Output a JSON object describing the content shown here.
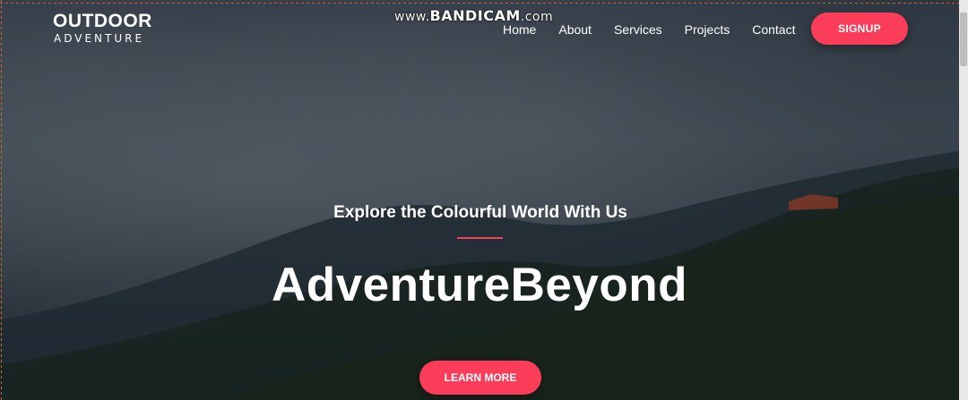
{
  "header": {
    "logo_main": "OUTDOOR",
    "logo_sub": "ADVENTURE",
    "nav": [
      "Home",
      "About",
      "Services",
      "Projects",
      "Contact"
    ],
    "signup_label": "SIGNUP"
  },
  "watermark": {
    "prefix": "www.",
    "brand": "BANDICAM",
    "suffix": ".com"
  },
  "hero": {
    "subtitle": "Explore the Colourful World With Us",
    "headline": "AdventureBeyond",
    "cta_label": "LEARN MORE"
  },
  "colors": {
    "accent": "#fb3d5a",
    "text": "#ffffff"
  }
}
